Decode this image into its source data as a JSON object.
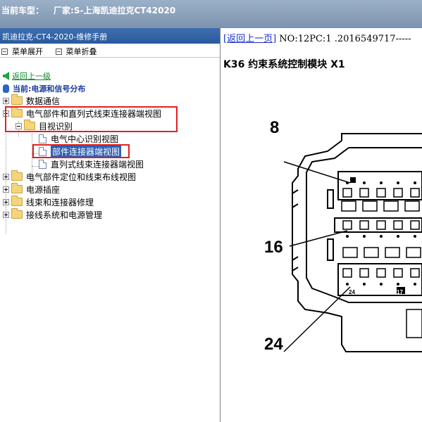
{
  "window": {
    "title_prefix": "当前车型：",
    "title_value": "厂家:S-上海凯迪拉克CT42020"
  },
  "sidebar": {
    "header": "凯迪拉克-CT4-2020-维修手册",
    "toolbar": {
      "expand_label": "菜单展开",
      "collapse_label": "菜单折叠"
    },
    "back_link": "返回上一级",
    "current_path": "当前:电源和信号分布",
    "tree": {
      "n1": "数据通信",
      "n2": "电气部件和直列式线束连接器端视图",
      "n2_1": "目视识别",
      "n2_1_1": "电气中心识别视图",
      "n2_1_2": "部件连接器端视图",
      "n2_1_3": "直列式线束连接器端视图",
      "n3": "电气部件定位和线束布线视图",
      "n4": "电源插座",
      "n5": "线束和连接器修理",
      "n6": "接线系统和电源管理"
    }
  },
  "content": {
    "back_link": "[返回上一页]",
    "doc_id": " NO:12PC:1 .2016549717-----",
    "title": "K36 约束系统控制模块 X1",
    "pin_labels": {
      "p8": "8",
      "p16": "16",
      "p24": "24"
    },
    "connector_marks": {
      "small_24": "24",
      "small_17": "17"
    }
  },
  "colors": {
    "titlebar": "#8aa0bb",
    "sidebar_header": "#2f62a8",
    "selection": "#2f5fb2",
    "highlight_box": "#e02020",
    "link": "#1a2fd0"
  }
}
